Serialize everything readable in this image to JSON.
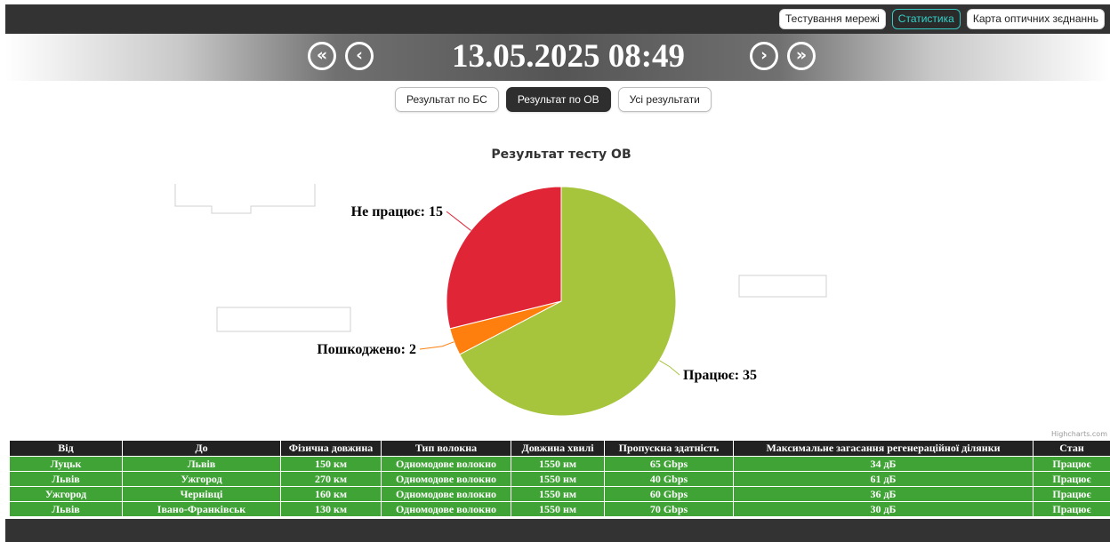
{
  "top_nav": {
    "items": [
      {
        "label": "Тестування мережі",
        "active": false
      },
      {
        "label": "Статистика",
        "active": true
      },
      {
        "label": "Карта оптичних зєднаннь",
        "active": false
      }
    ]
  },
  "date_bar": {
    "datetime": "13.05.2025 08:49",
    "first_label": "«",
    "prev_label": "‹",
    "next_label": "›",
    "last_label": "»"
  },
  "tabs": [
    {
      "label": "Результат по БС",
      "active": false
    },
    {
      "label": "Результат по ОВ",
      "active": true
    },
    {
      "label": "Усі результати",
      "active": false
    }
  ],
  "chart_data": {
    "type": "pie",
    "title": "Результат тесту ОВ",
    "slices": [
      {
        "name": "Працює",
        "value": 35,
        "label": "Працює: 35",
        "color": "#a6c43c"
      },
      {
        "name": "Пошкоджено",
        "value": 2,
        "label": "Пошкоджено: 2",
        "color": "#ff7f0e"
      },
      {
        "name": "Не працює",
        "value": 15,
        "label": "Не працює: 15",
        "color": "#e02537"
      }
    ],
    "credits": "Highcharts.com"
  },
  "table": {
    "columns": [
      "Від",
      "До",
      "Фізична довжина",
      "Тип волокна",
      "Довжина хвилі",
      "Пропускна здатність",
      "Максимальне загасання регенераційної ділянки",
      "Стан"
    ],
    "rows": [
      [
        "Луцьк",
        "Львів",
        "150 км",
        "Одномодове волокно",
        "1550 нм",
        "65 Gbps",
        "34 дБ",
        "Працює"
      ],
      [
        "Львів",
        "Ужгород",
        "270 км",
        "Одномодове волокно",
        "1550 нм",
        "40 Gbps",
        "61 дБ",
        "Працює"
      ],
      [
        "Ужгород",
        "Чернівці",
        "160 км",
        "Одномодове волокно",
        "1550 нм",
        "60 Gbps",
        "36 дБ",
        "Працює"
      ],
      [
        "Львів",
        "Івано-Франківськ",
        "130 км",
        "Одномодове волокно",
        "1550 нм",
        "70 Gbps",
        "30 дБ",
        "Працює"
      ]
    ]
  }
}
